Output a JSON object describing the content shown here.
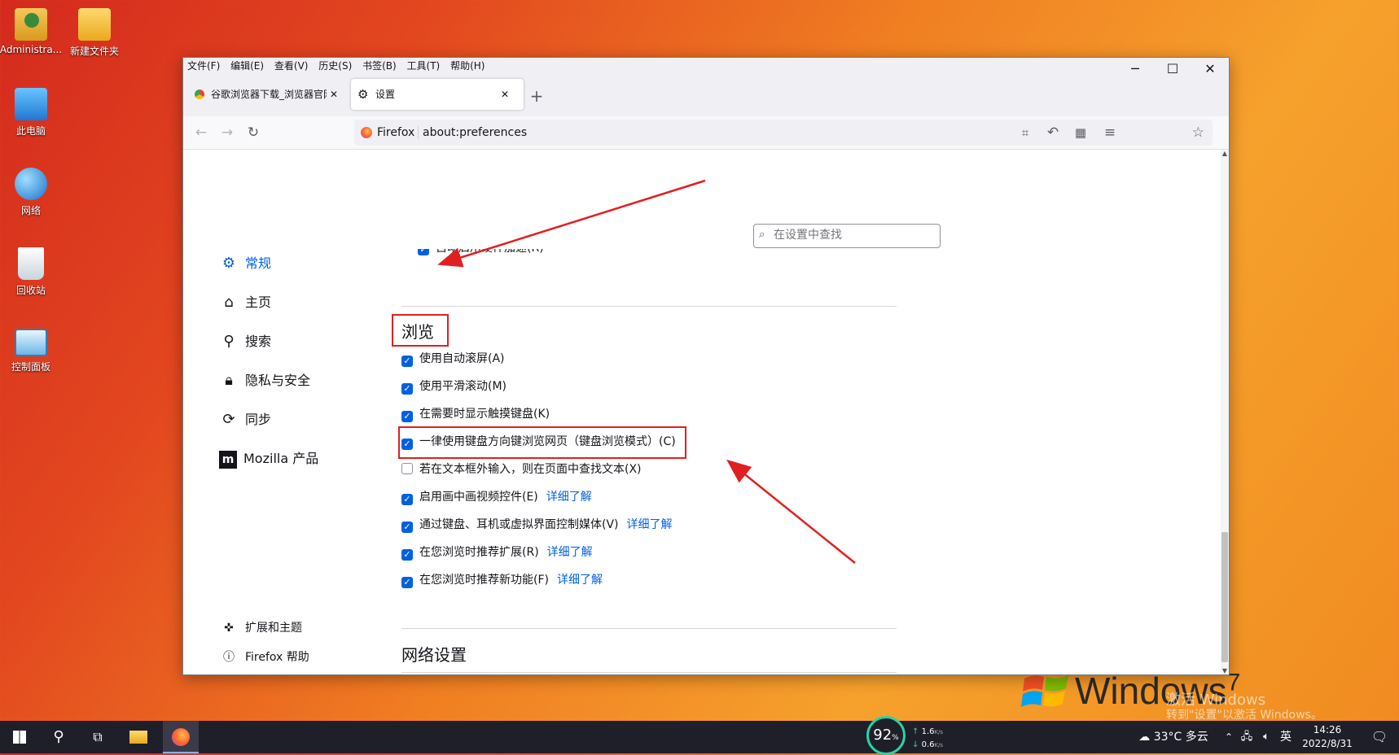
{
  "desktop": {
    "icons": [
      {
        "label": "Administra..."
      },
      {
        "label": "新建文件夹"
      },
      {
        "label": "此电脑"
      },
      {
        "label": "网络"
      },
      {
        "label": "回收站"
      },
      {
        "label": "控制面板"
      }
    ],
    "watermark": {
      "brand": "Windows",
      "version": "7",
      "activate_line1": "激活 Windows",
      "activate_line2": "转到\"设置\"以激活 Windows。"
    }
  },
  "window": {
    "menu": [
      "文件(F)",
      "编辑(E)",
      "查看(V)",
      "历史(S)",
      "书签(B)",
      "工具(T)",
      "帮助(H)"
    ],
    "tabs": [
      {
        "label": "谷歌浏览器下载_浏览器官网入口"
      },
      {
        "label": "设置"
      }
    ],
    "new_tab_icon": "plus-icon",
    "controls": {
      "minimize": "─",
      "maximize": "☐",
      "close": "✕"
    },
    "urlbar": {
      "identity": "Firefox",
      "url": "about:preferences"
    }
  },
  "settings": {
    "search_placeholder": "在设置中查找",
    "nav": [
      {
        "label": "常规",
        "icon": "gear-icon",
        "active": true
      },
      {
        "label": "主页",
        "icon": "home-icon"
      },
      {
        "label": "搜索",
        "icon": "search-icon"
      },
      {
        "label": "隐私与安全",
        "icon": "lock-icon"
      },
      {
        "label": "同步",
        "icon": "sync-icon"
      },
      {
        "label": "Mozilla 产品",
        "icon": "mozilla-icon"
      }
    ],
    "footer_nav": [
      {
        "label": "扩展和主题",
        "icon": "puzzle-icon"
      },
      {
        "label": "Firefox 帮助",
        "icon": "help-icon"
      }
    ],
    "cut_item": "自动启用硬件加速(R)",
    "section_title": "浏览",
    "options": [
      {
        "label": "使用自动滚屏(A)",
        "checked": true
      },
      {
        "label": "使用平滑滚动(M)",
        "checked": true
      },
      {
        "label": "在需要时显示触摸键盘(K)",
        "checked": true
      },
      {
        "label": "一律使用键盘方向键浏览网页（键盘浏览模式）(C)",
        "checked": true
      },
      {
        "label": "若在文本框外输入，则在页面中查找文本(X)",
        "checked": false
      },
      {
        "label": "启用画中画视频控件(E)",
        "checked": true,
        "link": "详细了解"
      },
      {
        "label": "通过键盘、耳机或虚拟界面控制媒体(V)",
        "checked": true,
        "link": "详细了解"
      },
      {
        "label": "在您浏览时推荐扩展(R)",
        "checked": true,
        "link": "详细了解"
      },
      {
        "label": "在您浏览时推荐新功能(F)",
        "checked": true,
        "link": "详细了解"
      }
    ],
    "next_section_title": "网络设置"
  },
  "taskbar": {
    "perf_percent": "92",
    "perf_unit": "%",
    "net_up": "1.6",
    "net_down": "0.6",
    "net_unit": "K/s",
    "weather": "33°C 多云",
    "ime": "英",
    "time": "14:26",
    "date": "2022/8/31"
  },
  "colors": {
    "accent": "#0061e0",
    "annotation": "#e02020"
  }
}
